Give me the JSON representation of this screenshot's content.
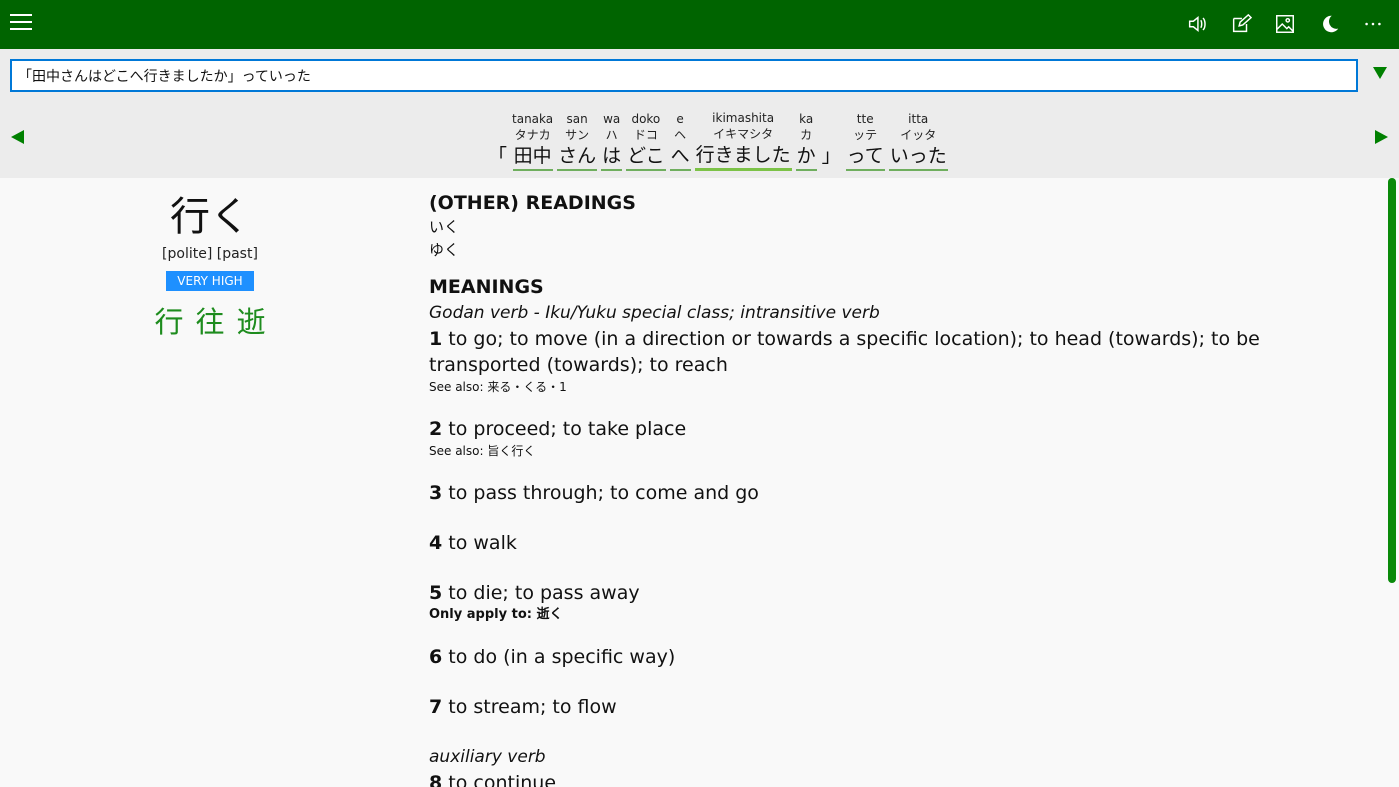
{
  "search": {
    "value": "「田中さんはどこへ行きましたか」っていった"
  },
  "sentence": {
    "tokens": [
      {
        "romaji": "",
        "kana": "",
        "surface": "「",
        "punct": true
      },
      {
        "romaji": "tanaka",
        "kana": "タナカ",
        "surface": "田中"
      },
      {
        "romaji": "san",
        "kana": "サン",
        "surface": "さん"
      },
      {
        "romaji": "wa",
        "kana": "ハ",
        "surface": "は"
      },
      {
        "romaji": "doko",
        "kana": "ドコ",
        "surface": "どこ"
      },
      {
        "romaji": "e",
        "kana": "ヘ",
        "surface": "へ"
      },
      {
        "romaji": "ikimashita",
        "kana": "イキマシタ",
        "surface": "行きました",
        "selected": true
      },
      {
        "romaji": "ka",
        "kana": "カ",
        "surface": "か"
      },
      {
        "romaji": "",
        "kana": "",
        "surface": "」",
        "punct": true
      },
      {
        "romaji": "tte",
        "kana": "ッテ",
        "surface": "って"
      },
      {
        "romaji": "itta",
        "kana": "イッタ",
        "surface": "いった"
      }
    ]
  },
  "entry": {
    "headword": "行く",
    "tags": "[polite] [past]",
    "frequency": "VERY HIGH",
    "kanji": [
      "行",
      "往",
      "逝"
    ],
    "readings_title": "(OTHER) READINGS",
    "readings": [
      "いく",
      "ゆく"
    ],
    "meanings_title": "MEANINGS",
    "pos1": "Godan verb - Iku/Yuku special class; intransitive verb",
    "senses": [
      {
        "num": "1",
        "text": "to go; to move (in a direction or towards a specific location); to head (towards); to be transported (towards); to reach",
        "note": "See also: 来る・くる・1"
      },
      {
        "num": "2",
        "text": "to proceed; to take place",
        "note": "See also: 旨く行く"
      },
      {
        "num": "3",
        "text": "to pass through; to come and go"
      },
      {
        "num": "4",
        "text": "to walk"
      },
      {
        "num": "5",
        "text": "to die; to pass away",
        "note_bold": "Only apply to: 逝く"
      },
      {
        "num": "6",
        "text": "to do (in a specific way)"
      },
      {
        "num": "7",
        "text": "to stream; to flow"
      }
    ],
    "pos2": "auxiliary verb",
    "sense8": {
      "num": "8",
      "text": "to continue"
    }
  },
  "colors": {
    "topbar": "#006400",
    "accent": "#008000",
    "badge": "#1e90ff",
    "kanji": "#1e8c1e"
  },
  "icons": {
    "menu": "hamburger-icon",
    "speaker": "speaker-icon",
    "edit": "edit-icon",
    "image": "image-icon",
    "moon": "moon-icon",
    "more": "more-icon"
  }
}
